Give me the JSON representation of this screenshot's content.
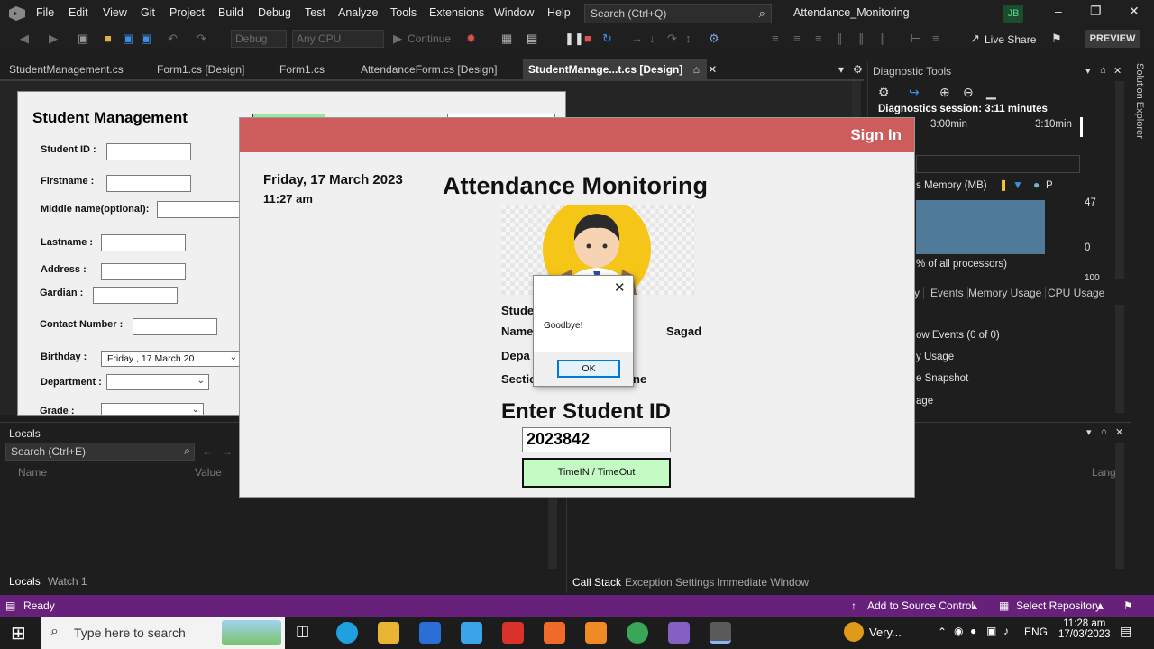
{
  "menubar": {
    "items": [
      "File",
      "Edit",
      "View",
      "Git",
      "Project",
      "Build",
      "Debug",
      "Test",
      "Analyze",
      "Tools",
      "Extensions",
      "Window",
      "Help"
    ],
    "search_placeholder": "Search (Ctrl+Q)",
    "solution_name": "Attendance_Monitoring",
    "user_initials": "JB"
  },
  "toolbar": {
    "config": "Debug",
    "platform": "Any CPU",
    "continue_label": "Continue",
    "live_share": "Live Share",
    "preview": "PREVIEW"
  },
  "doc_tabs": [
    "StudentManagement.cs",
    "Form1.cs [Design]",
    "Form1.cs",
    "AttendanceForm.cs [Design]",
    "StudentManage...t.cs [Design]"
  ],
  "student_form": {
    "title": "Student Management",
    "labels": {
      "student_id": "Student ID :",
      "firstname": "Firstname :",
      "middlename": "Middle name(optional):",
      "lastname": "Lastname :",
      "address": "Address :",
      "gardian": "Gardian :",
      "contact": "Contact Number :",
      "birthday": "Birthday :",
      "department": "Department :",
      "grade": "Grade :"
    },
    "birthday_value": "Friday    , 17    March    20"
  },
  "locals": {
    "title": "Locals",
    "search_placeholder": "Search (Ctrl+E)",
    "col_name": "Name",
    "col_value": "Value",
    "tabs": [
      "Locals",
      "Watch 1"
    ]
  },
  "diagnostics": {
    "title": "Diagnostic Tools",
    "session": "Diagnostics session: 3:11 minutes",
    "tick1": "3:00min",
    "tick2": "3:10min",
    "memory_label": "s Memory (MB)",
    "legend_p": "P",
    "max": "47",
    "min": "0",
    "cpu_label": "% of all processors)",
    "cpu_max": "100",
    "tabs": [
      "y",
      "Events",
      "Memory Usage",
      "CPU Usage"
    ],
    "events": "ow Events (0 of 0)",
    "usage": "y Usage",
    "snapshot": "e Snapshot",
    "age": "age"
  },
  "solution_explorer": "Solution Explorer",
  "callstack": {
    "lang": "Lang",
    "tabs": [
      "Call Stack",
      "Exception Settings",
      "Immediate Window"
    ]
  },
  "statusbar": {
    "ready": "Ready",
    "source_control": "Add to Source Control",
    "repository": "Select Repository"
  },
  "attendance": {
    "signin": "Sign In",
    "date": "Friday, 17 March 2023",
    "time": "11:27 am",
    "title": "Attendance Monitoring",
    "lbl_stude": "Stude",
    "lbl_name": "Name",
    "lbl_depa": "Depa",
    "lbl_secti": "Sectio",
    "val_name": "Sagad",
    "val_sect": "ne",
    "enter_id": "Enter Student ID",
    "student_id_value": "2023842",
    "timein_btn": "TimeIN / TimeOut"
  },
  "msgbox": {
    "text": "Goodbye!",
    "ok": "OK"
  },
  "taskbar": {
    "search_placeholder": "Type here to search",
    "weather": "Very...",
    "lang": "ENG",
    "time": "11:28 am",
    "date": "17/03/2023"
  },
  "colors": {
    "statusbar": "#68217a",
    "att_header": "#cd5c5c",
    "timein_bg": "#c4fbc4"
  }
}
